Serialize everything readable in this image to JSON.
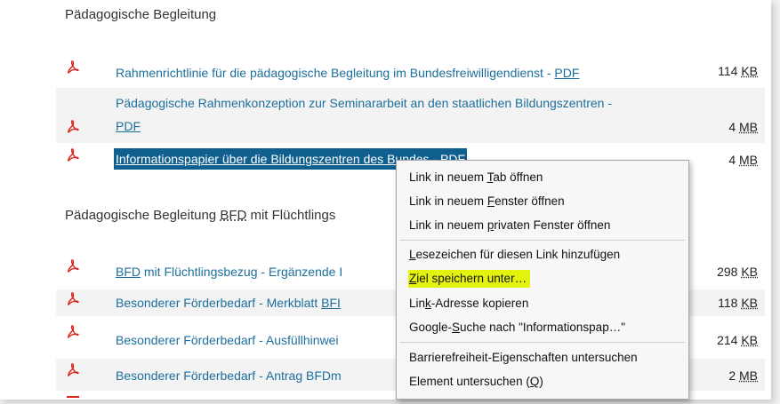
{
  "sections": [
    {
      "heading": "Pädagogische Begleitung",
      "rows": [
        {
          "icon": "pdf-icon",
          "title_line1": "Rahmenrichtlinie für die pädagogische Begleitung im Bundesfreiwilligendienst - ",
          "pdf": "PDF",
          "size_num": "114 ",
          "size_unit": "KB"
        },
        {
          "icon": "pdf-icon",
          "title_line1": "Pädagogische Rahmenkonzeption zur Seminararbeit an den staatlichen Bildungszentren -",
          "pdf": "PDF",
          "size_num": "4 ",
          "size_unit": "MB"
        },
        {
          "icon": "pdf-icon",
          "title_line1": "Informationspapier über die Bildungszentren des Bundes - ",
          "pdf": "PDF",
          "size_num": "4 ",
          "size_unit": "MB",
          "selected": true
        }
      ]
    },
    {
      "heading_text": "Pädagogische Begleitung ",
      "heading_abbr": "BFD",
      "heading_rest": " mit Flüchtlings",
      "rows": [
        {
          "icon": "pdf-icon",
          "abbr": "BFD",
          "title_line1": " mit Flüchtlingsbezug - Ergänzende I",
          "size_num": "298 ",
          "size_unit": "KB"
        },
        {
          "icon": "pdf-icon",
          "title_line1": "Besonderer Förderbedarf - Merkblatt ",
          "abbr": "BFI",
          "size_num": "118 ",
          "size_unit": "KB"
        },
        {
          "icon": "pdf-icon",
          "title_line1": "Besonderer Förderbedarf - Ausfüllhinwei",
          "size_num": "214 ",
          "size_unit": "KB"
        },
        {
          "icon": "pdf-icon",
          "title_line1": "Besonderer Förderbedarf - Antrag BFDm",
          "size_num": "2 ",
          "size_unit": "MB"
        }
      ]
    }
  ],
  "context_menu": {
    "items": [
      {
        "pre": "Link in neuem ",
        "key": "T",
        "post": "ab öffnen"
      },
      {
        "pre": "Link in neuem ",
        "key": "F",
        "post": "enster öffnen"
      },
      {
        "pre": "Link in neuem ",
        "key": "p",
        "post": "rivaten Fenster öffnen"
      },
      {
        "pre": "",
        "key": "L",
        "post": "esezeichen für diesen Link hinzufügen"
      },
      {
        "pre": "",
        "key": "Z",
        "post": "iel speichern unter…",
        "highlight": true
      },
      {
        "pre": "Lin",
        "key": "k",
        "post": "-Adresse kopieren"
      },
      {
        "pre": "Google-",
        "key": "S",
        "post": "uche nach \"Informationspap…\""
      },
      {
        "pre": "Barrierefreiheit-Eigenschaften untersuchen",
        "key": "",
        "post": ""
      },
      {
        "pre": "Element untersuchen (",
        "key": "Q",
        "post": ")"
      }
    ]
  },
  "colors": {
    "link": "#1c6f9d",
    "selection": "#0f5f8f",
    "highlight": "#e4f20f",
    "pdf_icon": "#d9251c"
  }
}
